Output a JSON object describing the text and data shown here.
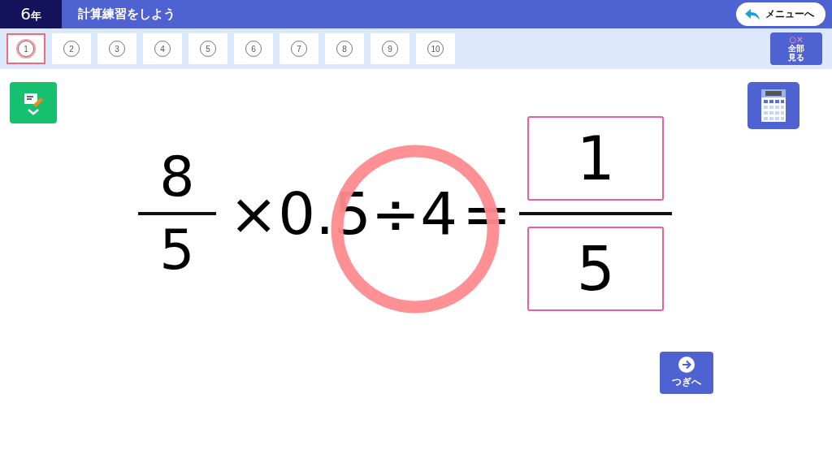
{
  "header": {
    "grade": "6",
    "grade_unit": "年",
    "title": "計算練習をしよう",
    "menu_button": "メニューへ"
  },
  "tabs": [
    {
      "label": "1",
      "selected": true
    },
    {
      "label": "2",
      "selected": false
    },
    {
      "label": "3",
      "selected": false
    },
    {
      "label": "4",
      "selected": false
    },
    {
      "label": "5",
      "selected": false
    },
    {
      "label": "6",
      "selected": false
    },
    {
      "label": "7",
      "selected": false
    },
    {
      "label": "8",
      "selected": false
    },
    {
      "label": "9",
      "selected": false
    },
    {
      "label": "10",
      "selected": false
    }
  ],
  "show_all_button": {
    "marks": "○×",
    "label": "全部見る"
  },
  "problem": {
    "numerator": "8",
    "denominator": "5",
    "expression": "×0.5÷4",
    "equals": "=",
    "answer_numerator": "1",
    "answer_denominator": "5",
    "correct": true
  },
  "next_button": "つぎへ"
}
